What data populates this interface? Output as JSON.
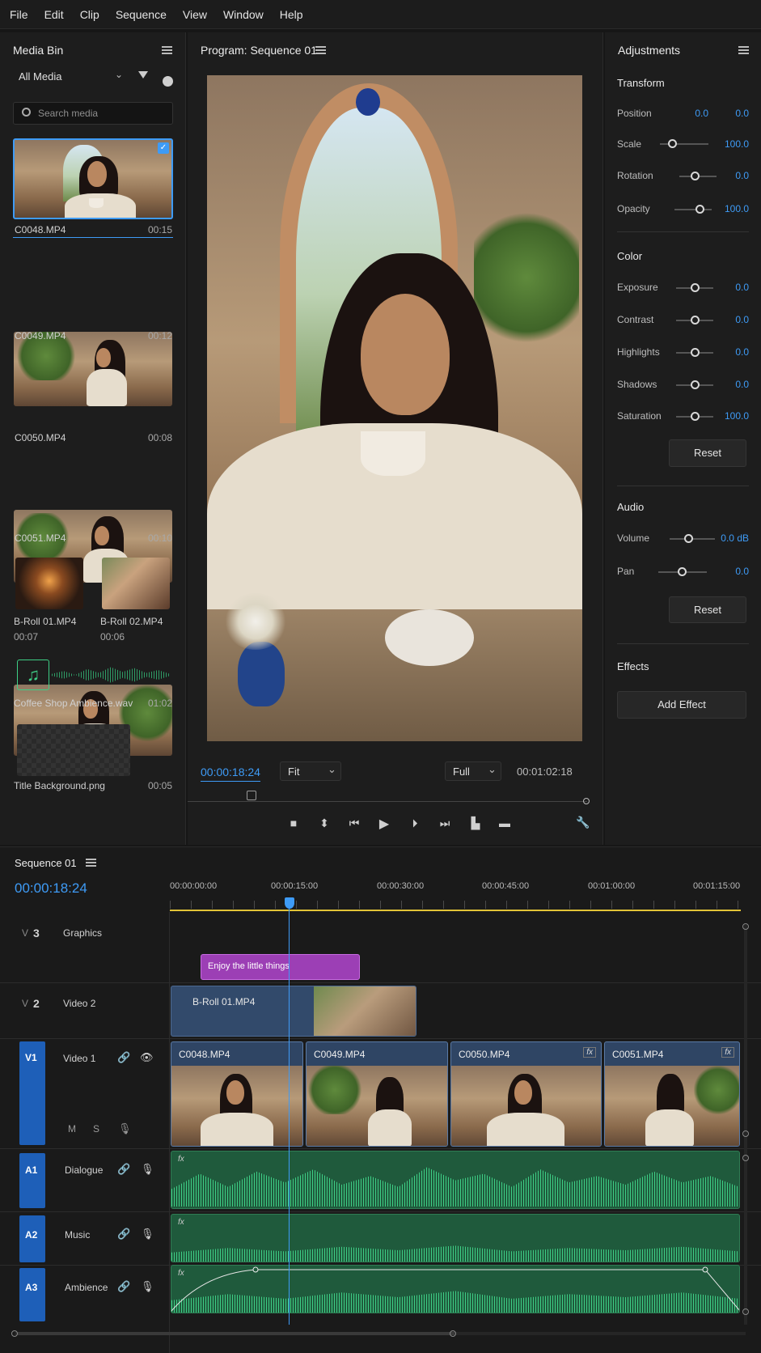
{
  "menu": [
    "File",
    "Edit",
    "Clip",
    "Sequence",
    "View",
    "Window",
    "Help"
  ],
  "media_bin": {
    "title": "Media Bin",
    "filter": "All Media",
    "search_placeholder": "Search media",
    "items": [
      {
        "name": "C0048.MP4",
        "duration": "00:15"
      },
      {
        "name": "C0049.MP4",
        "duration": "00:12"
      },
      {
        "name": "C0050.MP4",
        "duration": "00:08"
      },
      {
        "name": "C0051.MP4",
        "duration": "00:10"
      },
      {
        "name": "B-Roll 01.MP4",
        "duration": "00:07"
      },
      {
        "name": "B-Roll 02.MP4",
        "duration": "00:06"
      },
      {
        "name": "Coffee Shop Ambience.wav",
        "duration": "01:02"
      },
      {
        "name": "Title Background.png",
        "duration": "00:05"
      }
    ]
  },
  "program": {
    "title": "Program: Sequence 01",
    "current_time": "00:00:18:24",
    "fit": "Fit",
    "quality": "Full",
    "total_time": "00:01:02:18"
  },
  "adjustments": {
    "title": "Adjustments",
    "transform": {
      "heading": "Transform",
      "position_label": "Position",
      "position_x": "0.0",
      "position_y": "0.0",
      "scale_label": "Scale",
      "scale": "100.0",
      "rotation_label": "Rotation",
      "rotation": "0.0",
      "opacity_label": "Opacity",
      "opacity": "100.0"
    },
    "color": {
      "heading": "Color",
      "exposure_label": "Exposure",
      "exposure": "0.0",
      "contrast_label": "Contrast",
      "contrast": "0.0",
      "highlights_label": "Highlights",
      "highlights": "0.0",
      "shadows_label": "Shadows",
      "shadows": "0.0",
      "saturation_label": "Saturation",
      "saturation": "100.0",
      "reset": "Reset"
    },
    "audio": {
      "heading": "Audio",
      "volume_label": "Volume",
      "volume": "0.0 dB",
      "pan_label": "Pan",
      "pan": "0.0",
      "reset": "Reset"
    },
    "effects": {
      "heading": "Effects",
      "add": "Add Effect"
    }
  },
  "timeline": {
    "title": "Sequence 01",
    "current_time": "00:00:18:24",
    "ruler": [
      "00:00:00:00",
      "00:00:15:00",
      "00:00:30:00",
      "00:00:45:00",
      "00:01:00:00",
      "00:01:15:00"
    ],
    "tracks": {
      "v3": {
        "prefix": "V",
        "num": "3",
        "name": "Graphics"
      },
      "v2": {
        "prefix": "V",
        "num": "2",
        "name": "Video 2"
      },
      "v1": {
        "id": "V1",
        "name": "Video 1",
        "m": "M",
        "s": "S"
      },
      "a1": {
        "id": "A1",
        "name": "Dialogue"
      },
      "a2": {
        "id": "A2",
        "name": "Music"
      },
      "a3": {
        "id": "A3",
        "name": "Ambience"
      }
    },
    "clips": {
      "title": "Enjoy the little things",
      "broll": "B-Roll 01.MP4",
      "v1": [
        "C0048.MP4",
        "C0049.MP4",
        "C0050.MP4",
        "C0051.MP4"
      ],
      "fx": "fx"
    }
  },
  "colors": {
    "accent": "#3e9bf6",
    "audio": "#3ecf86",
    "title_clip": "#9c3fb5",
    "track_tab": "#1e5fb8"
  }
}
